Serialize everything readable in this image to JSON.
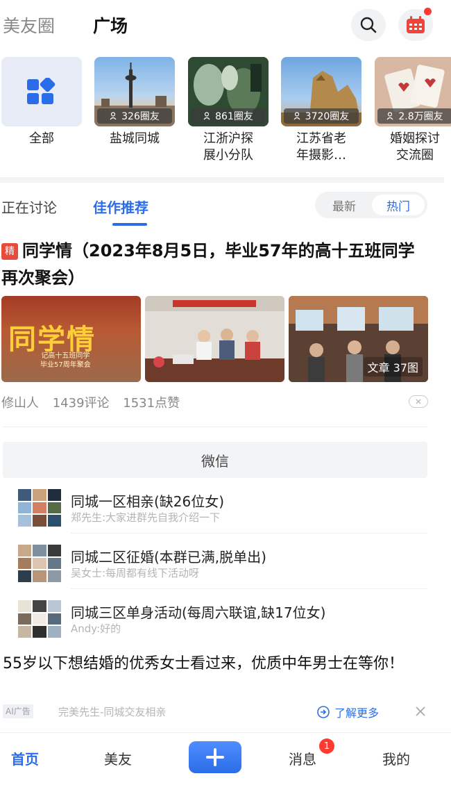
{
  "header": {
    "tab_inactive": "美友圈",
    "tab_active": "广场",
    "search_icon": "search-icon",
    "calendar_icon": "calendar-icon"
  },
  "circles": [
    {
      "name": "全部",
      "count": ""
    },
    {
      "name": "盐城同城",
      "count": "326圈友"
    },
    {
      "name": "江浙沪探\n展小分队",
      "count": "861圈友"
    },
    {
      "name": "江苏省老\n年摄影…",
      "count": "3720圈友"
    },
    {
      "name": "婚姻探讨\n交流圈",
      "count": "2.8万圈友"
    }
  ],
  "discussion_tabs": {
    "tab1": "正在讨论",
    "tab2": "佳作推荐",
    "sort_latest": "最新",
    "sort_hot": "热门"
  },
  "post": {
    "badge": "精",
    "title": "同学情（2023年8月5日，毕业57年的高十五班同学再次聚会）",
    "image1_text": "同学情",
    "image1_sub": "记高十五班同学\n毕业57周年聚会",
    "image_label": "文章  37图",
    "author": "修山人",
    "comments": "1439评论",
    "likes": "1531点赞"
  },
  "wechat": {
    "title": "微信",
    "groups": [
      {
        "name": "同城一区相亲(缺26位女)",
        "last": "郑先生:大家进群先自我介绍一下"
      },
      {
        "name": "同城二区征婚(本群已满,脱单出)",
        "last": "吴女士:每周都有线下活动呀"
      },
      {
        "name": "同城三区单身活动(每周六联谊,缺17位女)",
        "last": "Andy:好的"
      }
    ]
  },
  "ad": {
    "text": "55岁以下想结婚的优秀女士看过来，优质中年男士在等你！",
    "badge": "AI广告",
    "source": "完美先生-同城交友相亲",
    "learn_more": "了解更多"
  },
  "bottom_nav": {
    "home": "首页",
    "friends": "美友",
    "messages": "消息",
    "messages_badge": "1",
    "mine": "我的"
  },
  "colors": {
    "accent": "#2b6de8",
    "badge_red": "#ff3b30"
  }
}
